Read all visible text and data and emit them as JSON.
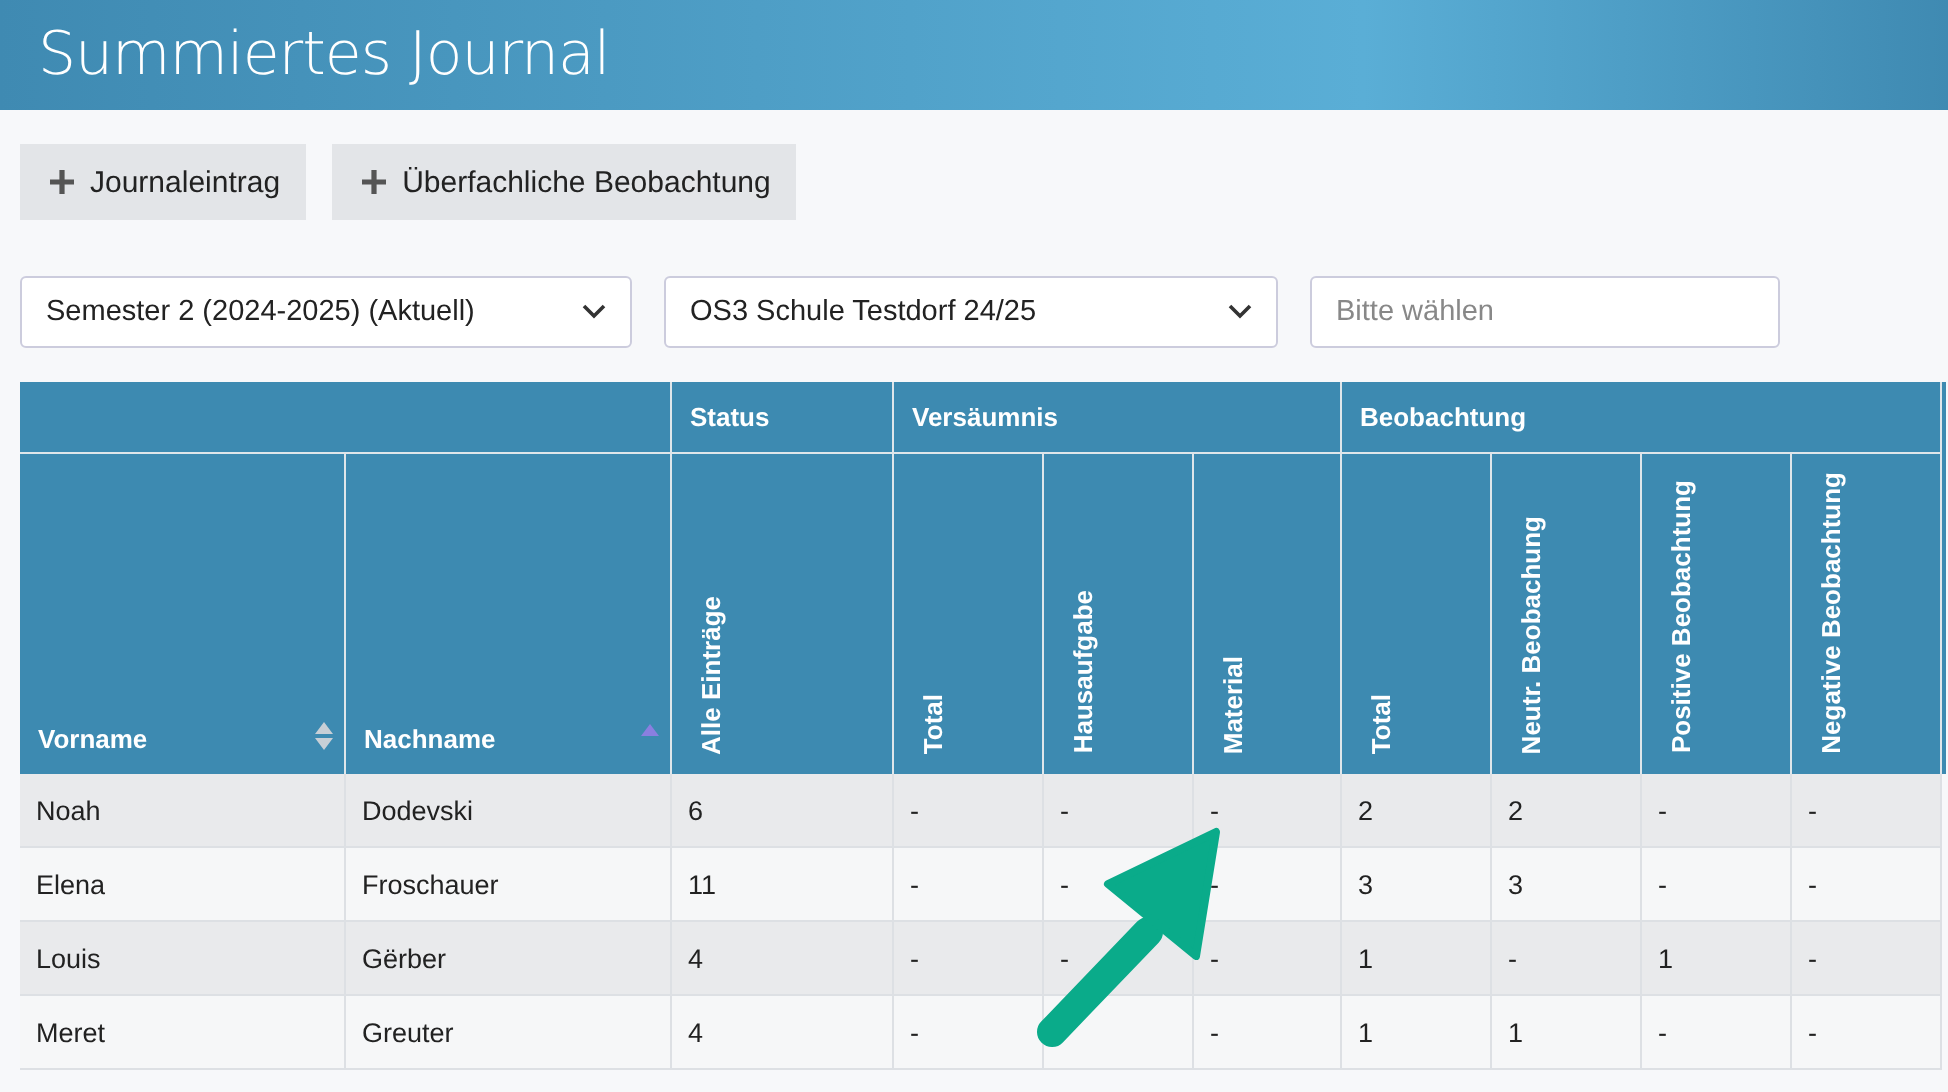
{
  "header": {
    "title": "Summiertes Journal"
  },
  "toolbar": {
    "buttons": [
      {
        "label": "Journaleintrag"
      },
      {
        "label": "Überfachliche Beobachtung"
      }
    ]
  },
  "filters": [
    {
      "kind": "select",
      "value": "Semester 2 (2024-2025) (Aktuell)"
    },
    {
      "kind": "select",
      "value": "OS3 Schule Testdorf 24/25"
    },
    {
      "kind": "input",
      "placeholder": "Bitte wählen"
    }
  ],
  "table": {
    "groups": [
      {
        "columns": [
          {
            "label": "Vorname",
            "kind": "sortable",
            "sorted": false
          },
          {
            "label": "Nachname",
            "kind": "sortable",
            "sorted": true
          }
        ]
      },
      {
        "label": "Status",
        "columns": [
          {
            "label": "Alle Einträge",
            "kind": "rotated"
          }
        ]
      },
      {
        "label": "Versäumnis",
        "columns": [
          {
            "label": "Total",
            "kind": "rotated"
          },
          {
            "label": "Hausaufgabe",
            "kind": "rotated"
          },
          {
            "label": "Material",
            "kind": "rotated"
          }
        ]
      },
      {
        "label": "Beobachtung",
        "columns": [
          {
            "label": "Total",
            "kind": "rotated"
          },
          {
            "label": "Neutr. Beobachung",
            "kind": "rotated"
          },
          {
            "label": "Positive Beobachtung",
            "kind": "rotated"
          },
          {
            "label": "Negative Beobachtung",
            "kind": "rotated"
          }
        ]
      }
    ],
    "rows": [
      [
        "Noah",
        "Dodevski",
        "6",
        "-",
        "-",
        "-",
        "2",
        "2",
        "-",
        "-"
      ],
      [
        "Elena",
        "Froschauer",
        "11",
        "-",
        "-",
        "-",
        "3",
        "3",
        "-",
        "-"
      ],
      [
        "Louis",
        "Gërber",
        "4",
        "-",
        "-",
        "-",
        "1",
        "-",
        "1",
        "-"
      ],
      [
        "Meret",
        "Greuter",
        "4",
        "-",
        null,
        "-",
        "1",
        "1",
        "-",
        "-"
      ]
    ]
  },
  "annotation": {
    "kind": "arrow",
    "color": "#0aab8a"
  }
}
